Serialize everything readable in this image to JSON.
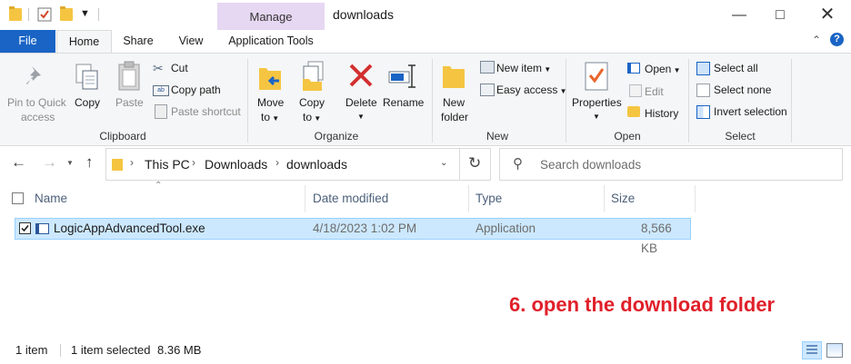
{
  "window": {
    "title": "downloads",
    "contextual_group": "Manage",
    "minimize_icon": "minimize-icon",
    "maximize_icon": "maximize-icon",
    "close_icon": "close-icon"
  },
  "tabs": [
    {
      "label": "File"
    },
    {
      "label": "Home"
    },
    {
      "label": "Share"
    },
    {
      "label": "View"
    },
    {
      "label": "Application Tools"
    }
  ],
  "ribbon": {
    "clipboard": {
      "group_label": "Clipboard",
      "pin_label_1": "Pin to Quick",
      "pin_label_2": "access",
      "copy": "Copy",
      "paste": "Paste",
      "cut": "Cut",
      "copy_path": "Copy path",
      "paste_shortcut": "Paste shortcut"
    },
    "organize": {
      "group_label": "Organize",
      "move_1": "Move",
      "move_2": "to",
      "copy_1": "Copy",
      "copy_2": "to",
      "delete": "Delete",
      "rename": "Rename"
    },
    "new": {
      "group_label": "New",
      "new_folder_1": "New",
      "new_folder_2": "folder",
      "new_item": "New item",
      "easy_access": "Easy access"
    },
    "open": {
      "group_label": "Open",
      "properties": "Properties",
      "open": "Open",
      "edit": "Edit",
      "history": "History"
    },
    "select": {
      "group_label": "Select",
      "select_all": "Select all",
      "select_none": "Select none",
      "invert_selection": "Invert selection"
    }
  },
  "address": {
    "crumbs": [
      "This PC",
      "Downloads",
      "downloads"
    ],
    "search_placeholder": "Search downloads"
  },
  "columns": [
    "Name",
    "Date modified",
    "Type",
    "Size"
  ],
  "files": [
    {
      "name": "LogicAppAdvancedTool.exe",
      "date": "4/18/2023 1:02 PM",
      "type": "Application",
      "size": "8,566 KB",
      "selected": true
    }
  ],
  "status": {
    "count": "1 item",
    "selection": "1 item selected",
    "size": "8.36 MB"
  },
  "annotation": "6. open the download folder",
  "colors": {
    "file_tab": "#1a64c5",
    "selection": "#cce8ff",
    "annotation": "#e0202a",
    "manage": "#e6d7f2"
  }
}
